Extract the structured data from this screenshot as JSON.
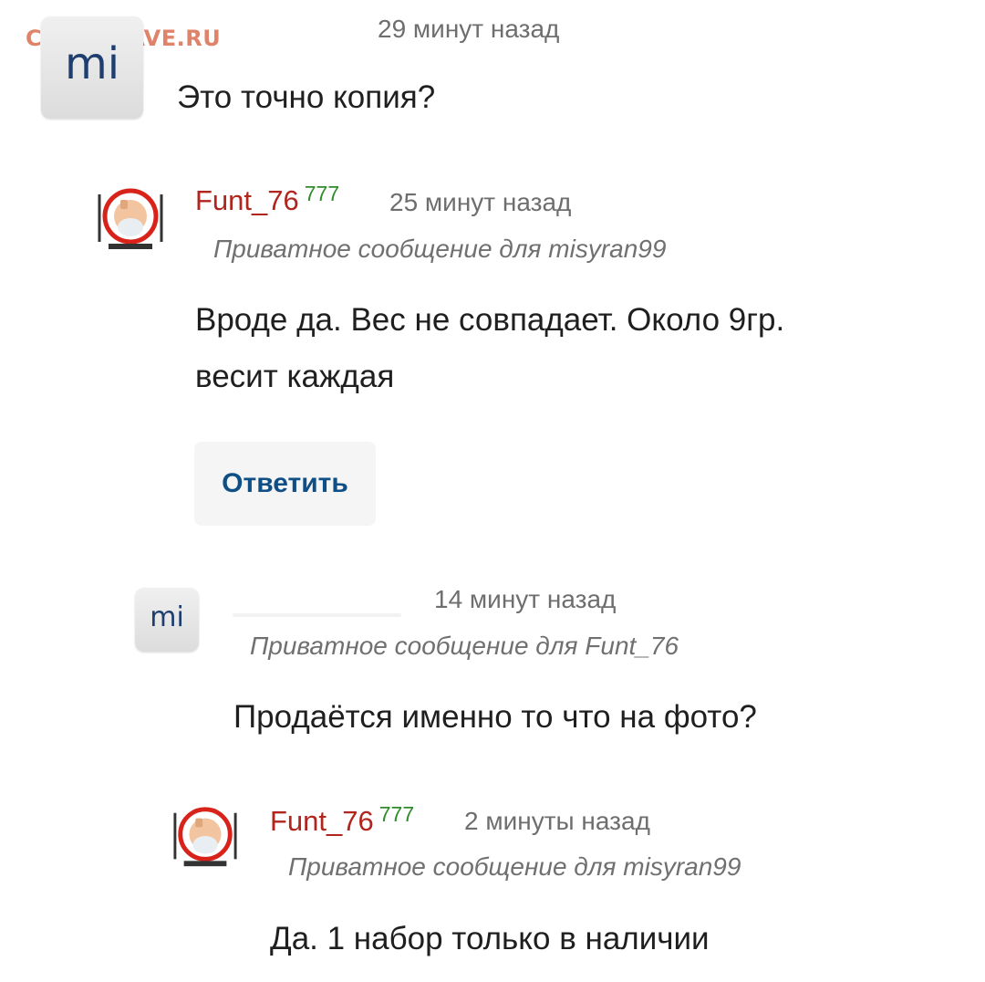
{
  "watermark": "COINS.LAVE.RU",
  "comments": [
    {
      "avatar_text": "mi",
      "time": "29 минут назад",
      "text": "Это точно копия?"
    },
    {
      "username": "Funt_76",
      "rating": "777",
      "time": "25 минут назад",
      "private_label": "Приватное сообщение для misyran99",
      "text_line1": "Вроде да. Вес не совпадает. Около 9гр.",
      "text_line2": "весит каждая",
      "reply_label": "Ответить"
    },
    {
      "avatar_text": "mi",
      "time": "14 минут назад",
      "private_label": "Приватное сообщение для Funt_76",
      "text": "Продаётся именно то что на фото?"
    },
    {
      "username": "Funt_76",
      "rating": "777",
      "time": "2 минуты назад",
      "private_label": "Приватное сообщение для misyran99",
      "text": "Да. 1 набор только в наличии"
    }
  ],
  "colors": {
    "username": "#b0251d",
    "rating": "#2e8c2a",
    "reply": "#0f4f86",
    "watermark": "#e0836b"
  },
  "icons": [
    "mi-avatar",
    "funt-avatar"
  ]
}
